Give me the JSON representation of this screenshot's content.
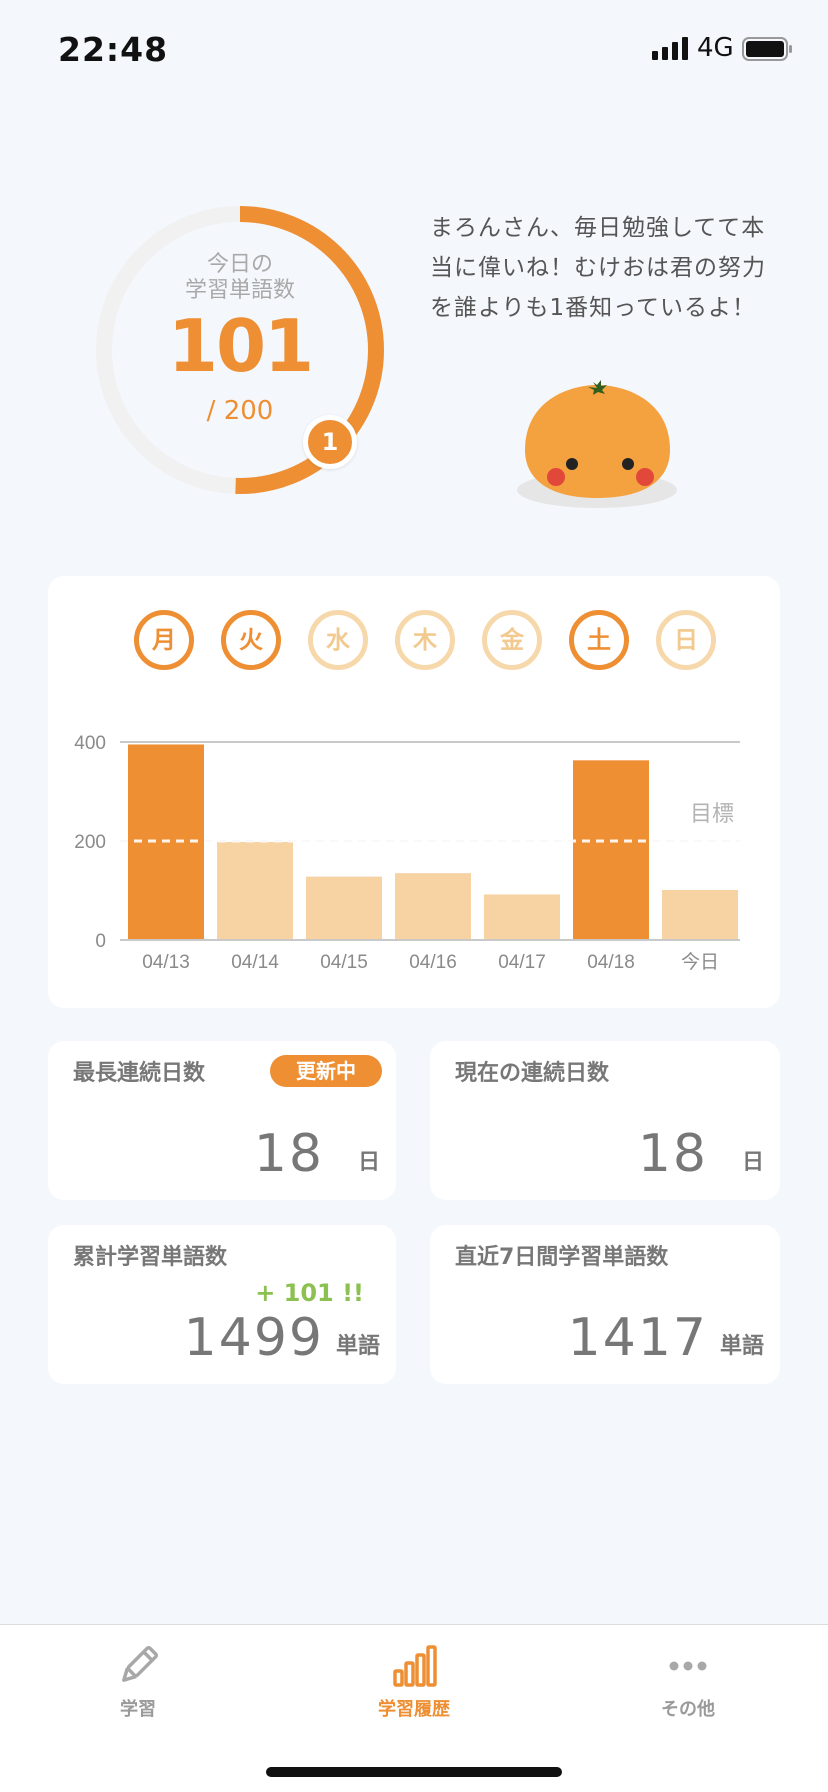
{
  "status_bar": {
    "time": "22:48",
    "network": "4G"
  },
  "daily_goal": {
    "label": "今日の\n学習単語数",
    "value": "101",
    "goal_text": "/ 200",
    "progress": 0.505,
    "badge": "1"
  },
  "message": "まろんさん、毎日勉強してて本当に偉いね！むけおは君の努力を誰よりも1番知っているよ！",
  "weekdays": [
    {
      "label": "月",
      "done": true
    },
    {
      "label": "火",
      "done": true
    },
    {
      "label": "水",
      "done": false
    },
    {
      "label": "木",
      "done": false
    },
    {
      "label": "金",
      "done": false
    },
    {
      "label": "土",
      "done": true
    },
    {
      "label": "日",
      "done": false
    }
  ],
  "chart_data": {
    "type": "bar",
    "categories": [
      "04/13",
      "04/14",
      "04/15",
      "04/16",
      "04/17",
      "04/18",
      "今日"
    ],
    "values": [
      395,
      198,
      128,
      135,
      92,
      363,
      101
    ],
    "goal": 200,
    "goal_label": "目標",
    "yticks": [
      0,
      200,
      400
    ],
    "ylim": [
      0,
      400
    ],
    "colors": {
      "met": "#ee8f34",
      "unmet": "#f7d2a2"
    }
  },
  "stats": {
    "longest_streak": {
      "title": "最長連続日数",
      "badge": "更新中",
      "value": "18",
      "unit": "日"
    },
    "current_streak": {
      "title": "現在の連続日数",
      "value": "18",
      "unit": "日"
    },
    "total_words": {
      "title": "累計学習単語数",
      "increment": "+ 101 !!",
      "value": "1499",
      "unit": "単語"
    },
    "recent_words": {
      "title": "直近7日間学習単語数",
      "value": "1417",
      "unit": "単語"
    }
  },
  "tabs": [
    {
      "label": "学習",
      "icon": "pencil-icon",
      "active": false
    },
    {
      "label": "学習履歴",
      "icon": "bar-chart-icon",
      "active": true
    },
    {
      "label": "その他",
      "icon": "more-icon",
      "active": false
    }
  ],
  "colors": {
    "accent": "#ee8f34",
    "accent_light": "#f7d2a2",
    "positive": "#8cc152",
    "background": "#f4f7fc"
  }
}
